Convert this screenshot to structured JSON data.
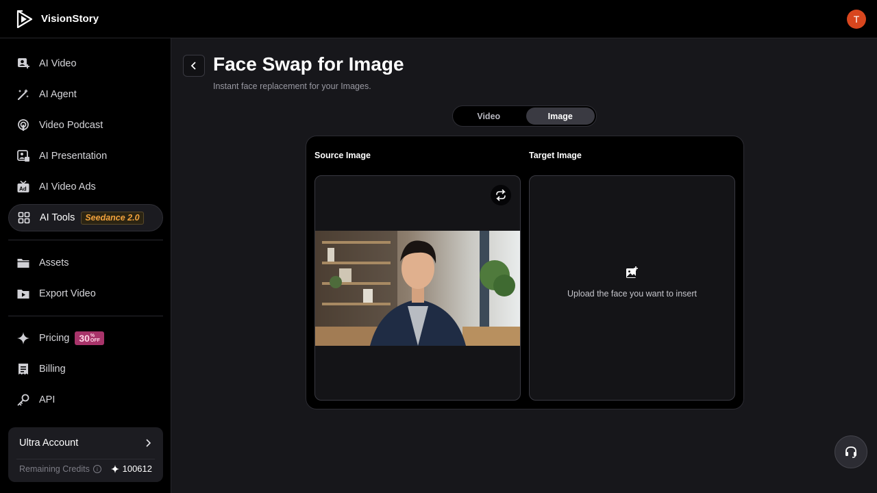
{
  "app": {
    "name": "VisionStory",
    "user_initial": "T",
    "accent": "#d8461e"
  },
  "sidebar": {
    "items": [
      {
        "label": "AI Video",
        "icon": "ai-video-icon"
      },
      {
        "label": "AI Agent",
        "icon": "magic-wand-icon"
      },
      {
        "label": "Video Podcast",
        "icon": "podcast-icon"
      },
      {
        "label": "AI Presentation",
        "icon": "presentation-icon"
      },
      {
        "label": "AI Video Ads",
        "icon": "ad-icon"
      },
      {
        "label": "AI Tools",
        "icon": "grid-icon",
        "badge": "Seedance 2.0",
        "active": true
      },
      {
        "label": "Assets",
        "icon": "folder-icon"
      },
      {
        "label": "Export Video",
        "icon": "export-folder-icon"
      },
      {
        "label": "Pricing",
        "icon": "sparkle-icon",
        "badge_number": "30",
        "badge_top": "%",
        "badge_bottom": "OFF"
      },
      {
        "label": "Billing",
        "icon": "receipt-icon"
      },
      {
        "label": "API",
        "icon": "key-icon"
      }
    ],
    "account": {
      "title": "Ultra Account",
      "credits_label": "Remaining Credits",
      "credits_value": "100612"
    }
  },
  "main": {
    "title": "Face Swap for Image",
    "subtitle": "Instant face replacement for your Images.",
    "tabs": [
      {
        "label": "Video",
        "active": false
      },
      {
        "label": "Image",
        "active": true
      }
    ],
    "source_label": "Source Image",
    "target_label": "Target Image",
    "upload_text": "Upload the face you want to insert"
  }
}
